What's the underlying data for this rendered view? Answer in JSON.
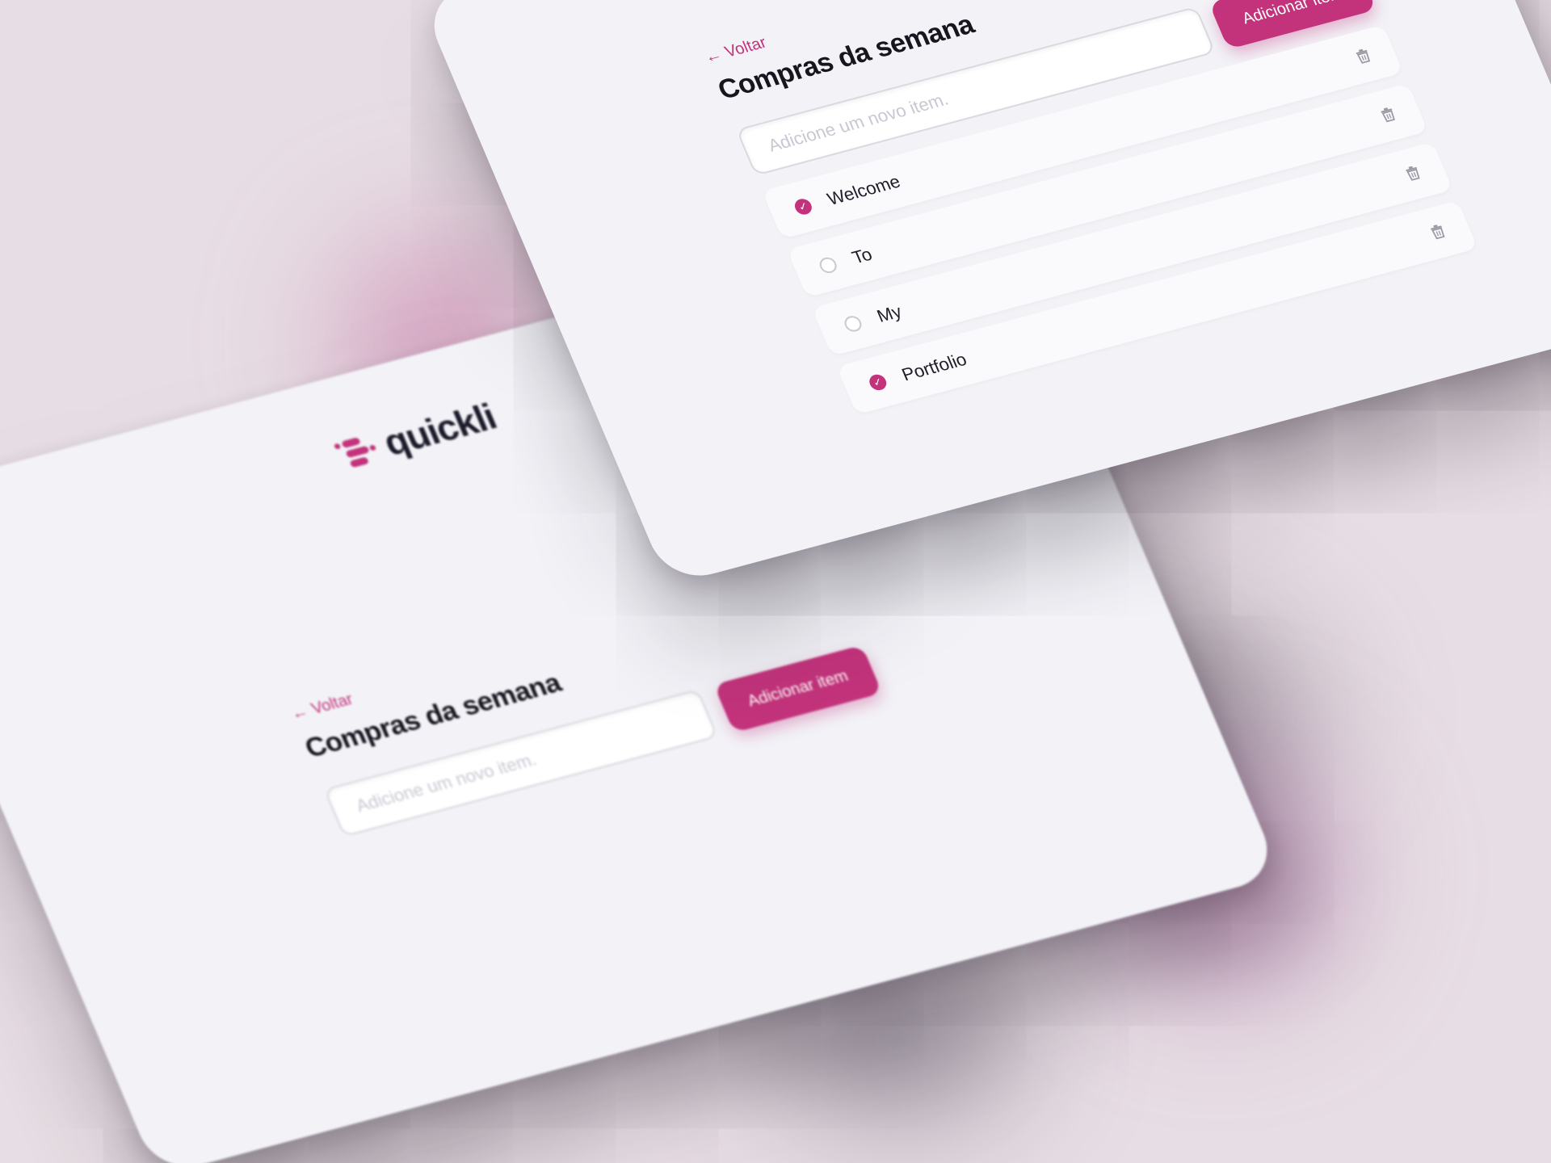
{
  "app": {
    "logo_text": "quickli"
  },
  "colors": {
    "accent": "#c2337b",
    "card_bg": "#f2f2f7",
    "background": "#e7dde4"
  },
  "back_screen": {
    "back_link_label": "Voltar",
    "title": "Compras da semana",
    "input_placeholder": "Adicione um novo item.",
    "add_button_label": "Adicionar item"
  },
  "front_screen": {
    "back_link_label": "Voltar",
    "title": "Compras da semana",
    "input_placeholder": "Adicione um novo item.",
    "add_button_label": "Adicionar item",
    "items": [
      {
        "label": "Welcome",
        "checked": true,
        "icon": "trash-icon"
      },
      {
        "label": "To",
        "checked": false,
        "icon": "trash-icon"
      },
      {
        "label": "My",
        "checked": false,
        "icon": "trash-icon"
      },
      {
        "label": "Portfolio",
        "checked": true,
        "icon": "trash-icon"
      }
    ]
  }
}
